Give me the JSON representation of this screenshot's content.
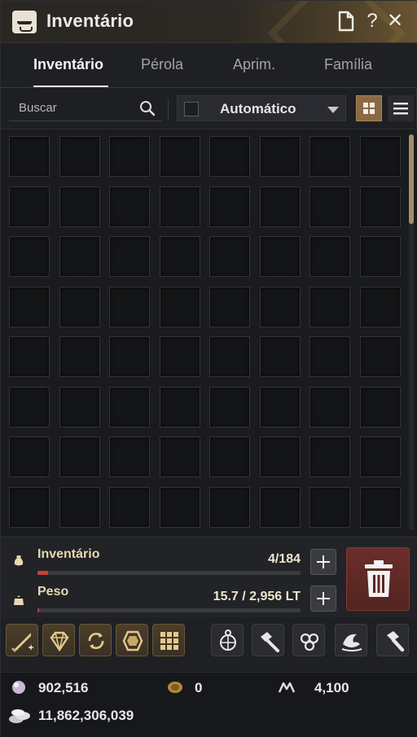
{
  "window": {
    "title": "Inventário"
  },
  "titlebar": {
    "doc_icon": "document-icon",
    "help_label": "?",
    "close_label": "✕"
  },
  "tabs": [
    {
      "label": "Inventário",
      "active": true
    },
    {
      "label": "Pérola",
      "active": false
    },
    {
      "label": "Aprim.",
      "active": false
    },
    {
      "label": "Família",
      "active": false
    }
  ],
  "search": {
    "placeholder": "Buscar",
    "value": ""
  },
  "sort": {
    "selected": "Automático",
    "checked": false
  },
  "view": {
    "grid": "grid-view-icon",
    "list": "list-view-icon",
    "active": "grid"
  },
  "grid": {
    "columns": 8,
    "rows": 8,
    "visible_rows": 8
  },
  "stats": {
    "inventory": {
      "label": "Inventário",
      "value": "4/184",
      "fill_fraction": 0.022
    },
    "weight": {
      "label": "Peso",
      "value": "15.7 / 2,956 LT",
      "fill_fraction": 0.005
    }
  },
  "toolbar": {
    "tools": [
      "sword-sparkle-icon",
      "gem-refine-icon",
      "cycle-item-icon",
      "crystal-icon",
      "grid-box-icon",
      "compass-ornament-icon",
      "hammer-icon",
      "triskelion-icon",
      "wave-splash-icon",
      "repair-hammer-icon"
    ]
  },
  "currency": {
    "pearl": "902,516",
    "coin": "0",
    "mileage": "4,100",
    "silver": "11,862,306,039"
  },
  "colors": {
    "accent_gold": "#8a6a45",
    "trash_red": "#6a2e2a",
    "bar_red": "#c84038"
  }
}
